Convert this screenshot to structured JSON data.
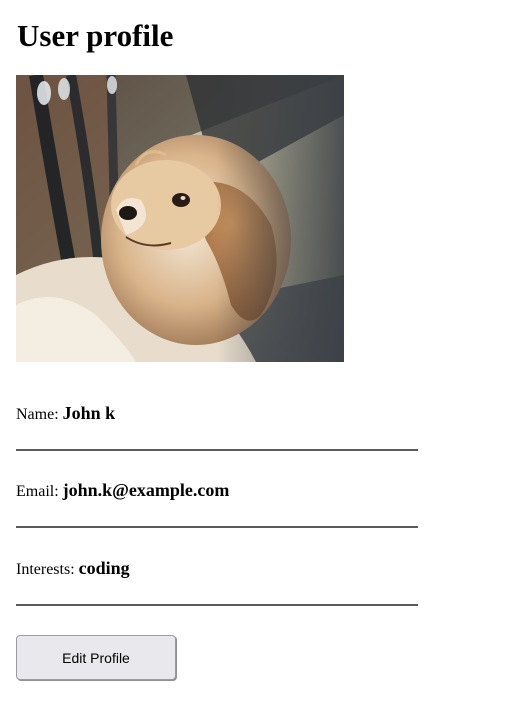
{
  "page": {
    "title": "User profile"
  },
  "profile": {
    "photo_alt": "Profile photo of a dog",
    "fields": [
      {
        "label": "Name:",
        "value": "John k"
      },
      {
        "label": "Email:",
        "value": "john.k@example.com"
      },
      {
        "label": "Interests:",
        "value": "coding"
      }
    ]
  },
  "actions": {
    "edit_label": "Edit Profile"
  },
  "colors": {
    "button_bg": "#e9e9ed",
    "divider": "#5a5a5a"
  }
}
